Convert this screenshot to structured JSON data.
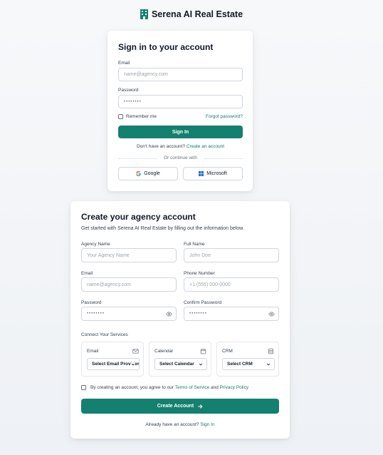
{
  "brand": {
    "name": "Serena AI Real Estate"
  },
  "signin": {
    "title": "Sign in to your account",
    "email_label": "Email",
    "email_placeholder": "name@agency.com",
    "password_label": "Password",
    "password_value": "••••••••",
    "remember_label": "Remember me",
    "forgot_label": "Forgot password?",
    "submit_label": "Sign In",
    "no_account_text": "Don't have an account?",
    "create_link": "Create an account",
    "continue_with": "Or continue with",
    "google_label": "Google",
    "microsoft_label": "Microsoft"
  },
  "create": {
    "title": "Create your agency account",
    "subtitle": "Get started with Serena AI Real Estate by filling out the information below.",
    "agency_label": "Agency Name",
    "agency_placeholder": "Your Agency Name",
    "fullname_label": "Full Name",
    "fullname_placeholder": "John Doe",
    "email_label": "Email",
    "email_placeholder": "name@agency.com",
    "phone_label": "Phone Number",
    "phone_placeholder": "+1 (555) 000-0000",
    "password_label": "Password",
    "password_value": "••••••••",
    "confirm_label": "Confirm Password",
    "confirm_value": "••••••••",
    "services_label": "Connect Your Services",
    "services": [
      {
        "name": "Email",
        "select": "Select Email Provider",
        "icon": "envelope-icon"
      },
      {
        "name": "Calendar",
        "select": "Select Calendar",
        "icon": "calendar-icon"
      },
      {
        "name": "CRM",
        "select": "Select CRM",
        "icon": "database-icon"
      }
    ],
    "terms_prefix": "By creating an account, you agree to our",
    "terms_link": "Terms of Service",
    "terms_and": "and",
    "privacy_link": "Privacy Policy",
    "submit_label": "Create Account",
    "submit_icon": "arrow-right-icon",
    "have_account_text": "Already have an account?",
    "signin_link": "Sign In"
  },
  "colors": {
    "accent": "#14806f",
    "link": "#0f7c6c"
  }
}
